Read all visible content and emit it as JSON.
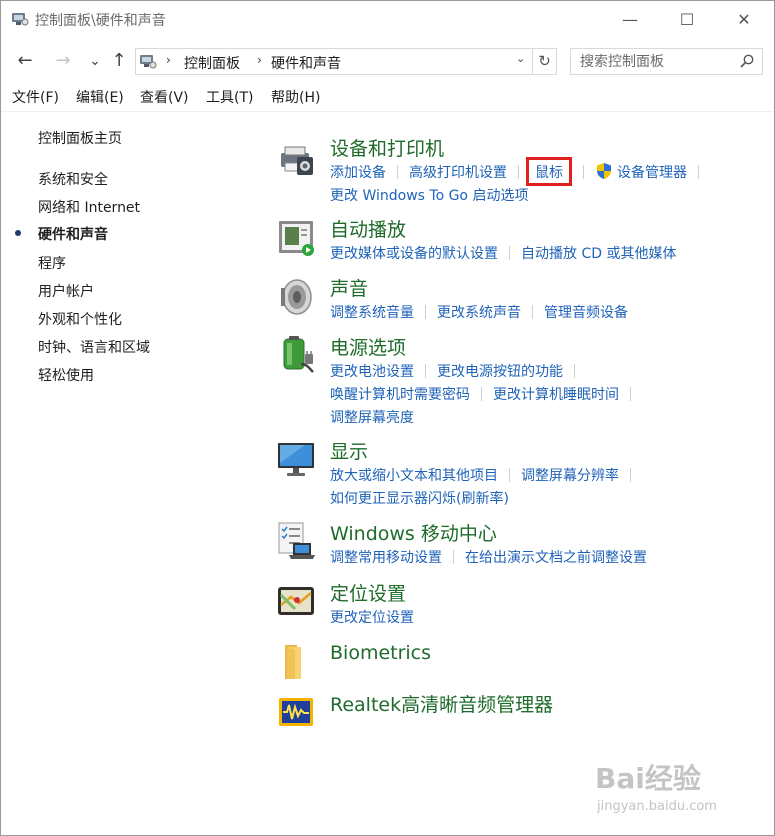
{
  "window": {
    "title": "控制面板\\硬件和声音",
    "minimize_glyph": "—",
    "maximize_glyph": "☐",
    "close_glyph": "✕"
  },
  "nav": {
    "back_glyph": "←",
    "forward_glyph": "→",
    "recent_glyph": "⌄",
    "up_glyph": "↑",
    "refresh_glyph": "↻"
  },
  "address": {
    "crumbs": [
      "控制面板",
      "硬件和声音"
    ],
    "separator": "›",
    "dropdown_glyph": "⌄"
  },
  "search": {
    "placeholder": "搜索控制面板"
  },
  "menu": [
    "文件(F)",
    "编辑(E)",
    "查看(V)",
    "工具(T)",
    "帮助(H)"
  ],
  "sidebar": {
    "home": "控制面板主页",
    "items": [
      "系统和安全",
      "网络和 Internet",
      "硬件和声音",
      "程序",
      "用户帐户",
      "外观和个性化",
      "时钟、语言和区域",
      "轻松使用"
    ],
    "current_index": 2
  },
  "categories": [
    {
      "title": "设备和打印机",
      "icon": "printer-icon",
      "rows": [
        [
          "添加设备",
          "高级打印机设置",
          "鼠标",
          "设备管理器"
        ],
        [
          "更改 Windows To Go 启动选项"
        ]
      ],
      "highlighted_link": "鼠标"
    },
    {
      "title": "自动播放",
      "icon": "autoplay-icon",
      "rows": [
        [
          "更改媒体或设备的默认设置",
          "自动播放 CD 或其他媒体"
        ]
      ]
    },
    {
      "title": "声音",
      "icon": "speaker-icon",
      "rows": [
        [
          "调整系统音量",
          "更改系统声音",
          "管理音频设备"
        ]
      ]
    },
    {
      "title": "电源选项",
      "icon": "battery-icon",
      "rows": [
        [
          "更改电池设置",
          "更改电源按钮的功能"
        ],
        [
          "唤醒计算机时需要密码",
          "更改计算机睡眠时间"
        ],
        [
          "调整屏幕亮度"
        ]
      ]
    },
    {
      "title": "显示",
      "icon": "monitor-icon",
      "rows": [
        [
          "放大或缩小文本和其他项目",
          "调整屏幕分辨率"
        ],
        [
          "如何更正显示器闪烁(刷新率)"
        ]
      ]
    },
    {
      "title": "Windows 移动中心",
      "icon": "mobility-center-icon",
      "rows": [
        [
          "调整常用移动设置",
          "在给出演示文档之前调整设置"
        ]
      ]
    },
    {
      "title": "定位设置",
      "icon": "gps-icon",
      "rows": [
        [
          "更改定位设置"
        ]
      ]
    },
    {
      "title": "Biometrics",
      "icon": "folder-icon",
      "rows": []
    },
    {
      "title": "Realtek高清晰音频管理器",
      "icon": "realtek-audio-icon",
      "rows": []
    }
  ],
  "watermark": {
    "logo": "Bai经验",
    "url": "jingyan.baidu.com"
  },
  "colors": {
    "link": "#1f63b8",
    "category_title": "#1e6b2a",
    "highlight_border": "#e02020"
  }
}
